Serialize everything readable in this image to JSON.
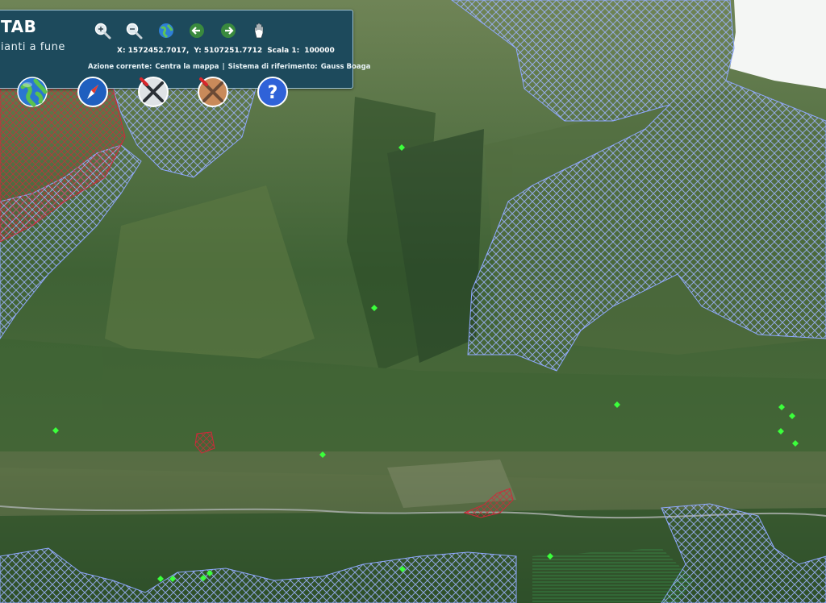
{
  "app": {
    "title": "TAB",
    "subtitle": "ianti a fune"
  },
  "toolbar": {
    "tools": [
      {
        "name": "zoom-in-icon"
      },
      {
        "name": "zoom-out-icon"
      },
      {
        "name": "full-extent-icon"
      },
      {
        "name": "previous-view-icon"
      },
      {
        "name": "next-view-icon"
      },
      {
        "name": "pan-hand-icon"
      }
    ]
  },
  "coordinates": {
    "x_label": "X: 1572452.7017,",
    "y_label": "Y: 5107251.7712",
    "scale_label": "Scala 1:",
    "scale_value": "100000"
  },
  "status": {
    "action_label": "Azione corrente:",
    "action_value": "Centra la mappa",
    "separator": "|",
    "crs_label": "Sistema di riferimento:",
    "crs_value": "Gauss Boaga"
  },
  "big_buttons": [
    {
      "name": "globe-button-icon"
    },
    {
      "name": "compass-button-icon"
    },
    {
      "name": "tools-button-icon"
    },
    {
      "name": "tools-disabled-button-icon"
    },
    {
      "name": "help-button-icon"
    }
  ],
  "colors": {
    "panel": "#1d4a5c",
    "hatch_blue": "#8fa8ff",
    "hatch_red": "#d0283a",
    "marker_green": "#3bff3b"
  }
}
